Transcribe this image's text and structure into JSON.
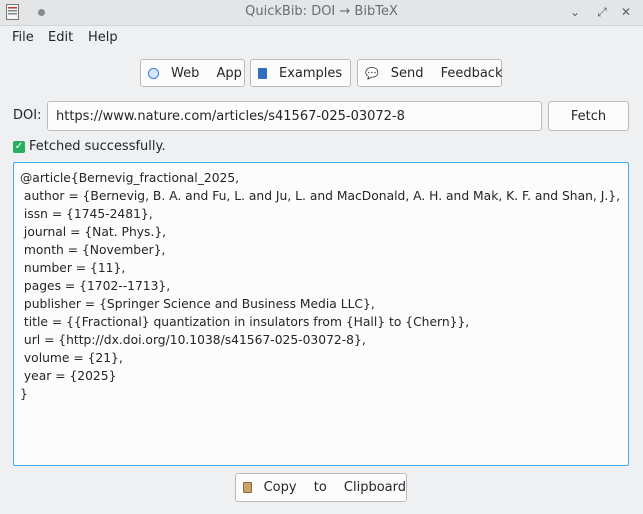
{
  "window": {
    "title": "QuickBib: DOI → BibTeX"
  },
  "menu": {
    "file": "File",
    "edit": "Edit",
    "help": "Help"
  },
  "toolbar": {
    "web_app": "Web App",
    "examples": "Examples",
    "send_feedback": "Send Feedback"
  },
  "doi": {
    "label": "DOI:",
    "value": "https://www.nature.com/articles/s41567-025-03072-8",
    "fetch": "Fetch"
  },
  "status": {
    "text": "Fetched successfully."
  },
  "bibtex": {
    "lines": [
      "@article{Bernevig_fractional_2025,",
      " author = {Bernevig, B. A. and Fu, L. and Ju, L. and MacDonald, A. H. and Mak, K. F. and Shan, J.},",
      " issn = {1745-2481},",
      " journal = {Nat. Phys.},",
      " month = {November},",
      " number = {11},",
      " pages = {1702--1713},",
      " publisher = {Springer Science and Business Media LLC},",
      " title = {{Fractional} quantization in insulators from {Hall} to {Chern}},",
      " url = {http://dx.doi.org/10.1038/s41567-025-03072-8},",
      " volume = {21},",
      " year = {2025}",
      "}"
    ]
  },
  "copy": {
    "label": "Copy to Clipboard"
  },
  "icons": {
    "app": "app-icon",
    "web_app": "globe-icon",
    "examples": "book-icon",
    "send_feedback": "speech-bubble-icon",
    "status": "checkmark-icon",
    "copy": "clipboard-icon"
  },
  "colors": {
    "focus_border": "#3daee9",
    "success": "#27ae60"
  }
}
